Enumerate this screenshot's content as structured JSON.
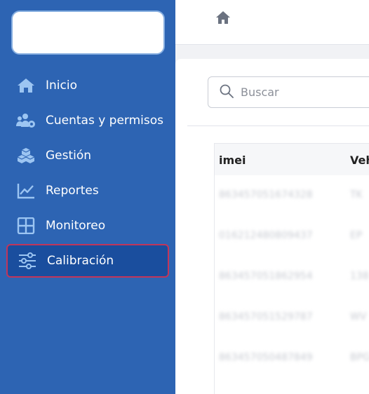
{
  "sidebar": {
    "items": [
      {
        "label": "Inicio",
        "icon": "home-icon"
      },
      {
        "label": "Cuentas y permisos",
        "icon": "users-cog-icon"
      },
      {
        "label": "Gestión",
        "icon": "cubes-icon"
      },
      {
        "label": "Reportes",
        "icon": "line-chart-icon"
      },
      {
        "label": "Monitoreo",
        "icon": "grid-icon"
      },
      {
        "label": "Calibración",
        "icon": "sliders-icon",
        "active": true
      }
    ]
  },
  "search": {
    "placeholder": "Buscar"
  },
  "table": {
    "columns": [
      "imei",
      "Veh"
    ],
    "rows": [
      [
        "863457051674328",
        "TK"
      ],
      [
        "016212480809437",
        "EP"
      ],
      [
        "863457051862954",
        "138"
      ],
      [
        "863457051529787",
        "WV"
      ],
      [
        "863457050487849",
        "BPG"
      ]
    ]
  },
  "colors": {
    "sidebar": "#2d64b3",
    "active_item": "#1a4e9e",
    "active_border": "#c2355a"
  }
}
